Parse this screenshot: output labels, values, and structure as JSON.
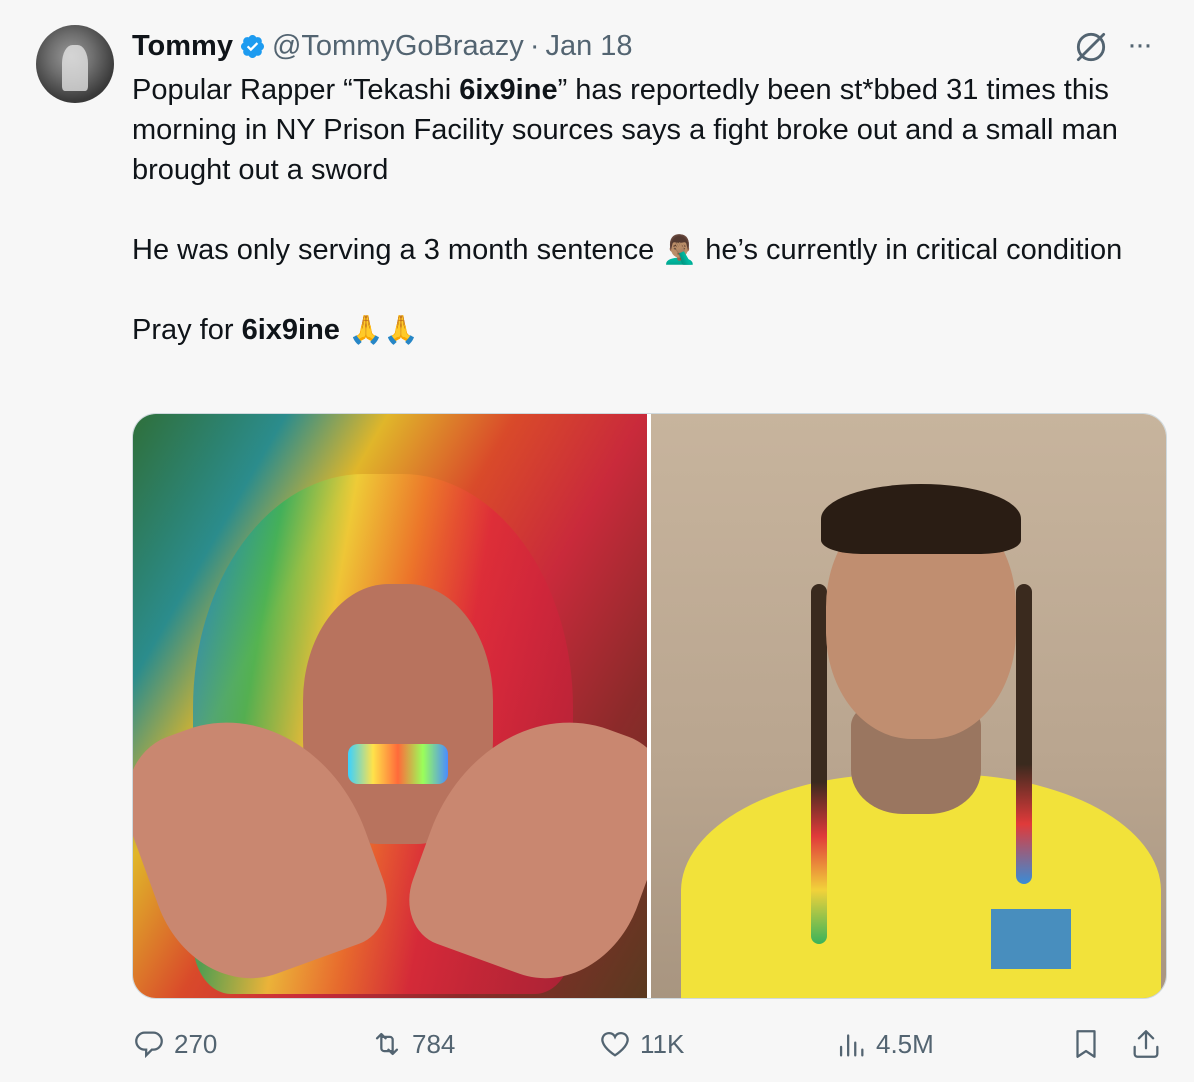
{
  "tweet": {
    "author_name": "Tommy",
    "author_handle": "@TommyGoBraazy",
    "separator": "·",
    "date": "Jan 18",
    "text": {
      "p1_before": "Popular Rapper “Tekashi ",
      "p1_bold": "6ix9ine",
      "p1_after": "” has reportedly been st*bbed 31 times this morning in NY Prison Facility sources says a fight broke out and a small man brought out a sword",
      "p2_before": "He was only serving a 3 month sentence ",
      "p2_emoji": "🤦🏽‍♂️",
      "p2_after": " he’s currently in critical condition",
      "p3_before": "Pray for ",
      "p3_bold": "6ix9ine",
      "p3_emoji": " 🙏🙏"
    }
  },
  "actions": {
    "reply_count": "270",
    "repost_count": "784",
    "like_count": "11K",
    "views_count": "4.5M"
  },
  "icons": {
    "verified": "verified-badge-icon",
    "grok": "grok-icon",
    "more": "more-icon",
    "reply": "reply-icon",
    "repost": "repost-icon",
    "like": "heart-icon",
    "views": "views-icon",
    "bookmark": "bookmark-icon",
    "share": "share-icon"
  },
  "colors": {
    "verified_blue": "#1d9bf0",
    "secondary_text": "#536471",
    "primary_text": "#0f1419"
  }
}
